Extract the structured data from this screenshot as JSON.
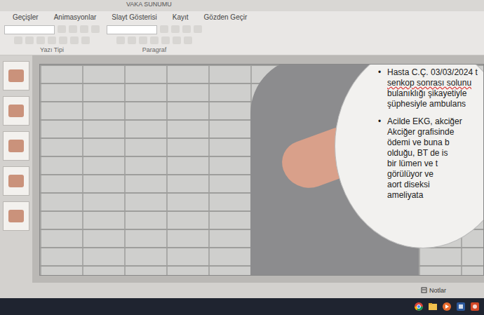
{
  "window": {
    "title": "VAKA SUNUMU"
  },
  "ribbon": {
    "tabs": [
      {
        "label": "Geçişler"
      },
      {
        "label": "Animasyonlar"
      },
      {
        "label": "Slayt Gösterisi"
      },
      {
        "label": "Kayıt"
      },
      {
        "label": "Gözden Geçir"
      }
    ],
    "groups": [
      "Yazı Tipi",
      "Paragraf"
    ]
  },
  "slide": {
    "paragraphs": [
      {
        "bullet": "•",
        "lines": [
          {
            "text": "Hasta C.Ç. 03/03/2024 t",
            "misspelled": false
          },
          {
            "text": "senkop sonrası solunu",
            "misspelled": true
          },
          {
            "text": "bulanıklığı şikayetiyle",
            "misspelled": false
          },
          {
            "text": "şüphesiyle ambulans",
            "misspelled": false
          }
        ]
      },
      {
        "bullet": "•",
        "lines": [
          {
            "text": "Acilde EKG, akciğer",
            "misspelled": false
          },
          {
            "text": "Akciğer grafisinde",
            "misspelled": false
          },
          {
            "text": "ödemi ve buna b",
            "misspelled": false
          },
          {
            "text": "olduğu, BT de is",
            "misspelled": false
          },
          {
            "text": "bir lümen ve t",
            "misspelled": false
          },
          {
            "text": "görülüyor ve",
            "misspelled": false
          },
          {
            "text": "aort diseksi",
            "misspelled": false
          },
          {
            "text": "ameliyata",
            "misspelled": false
          }
        ]
      }
    ]
  },
  "status_bar": {
    "notes": "Notlar"
  }
}
